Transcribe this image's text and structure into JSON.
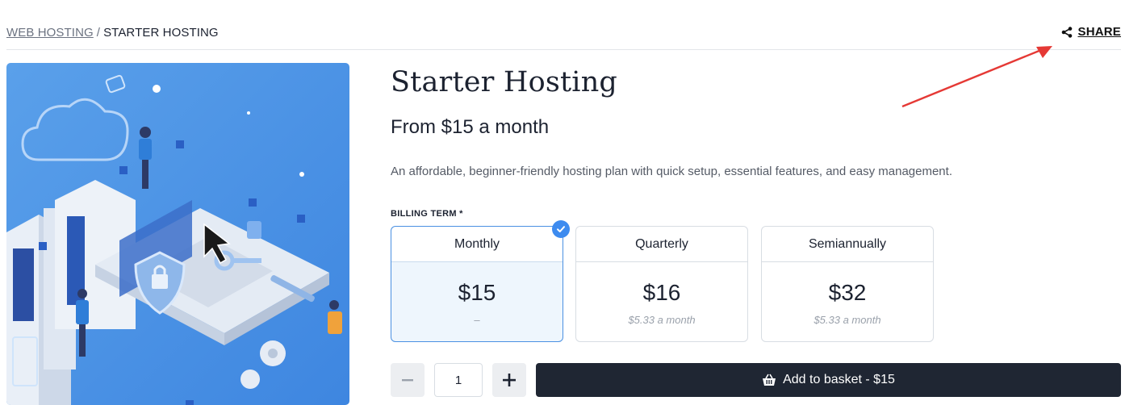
{
  "breadcrumb": {
    "parent": "WEB HOSTING",
    "separator": "/",
    "current": "STARTER HOSTING"
  },
  "share": {
    "label": "SHARE",
    "icon": "share-icon"
  },
  "product": {
    "title": "Starter Hosting",
    "price_from": "From $15 a month",
    "description": "An affordable, beginner-friendly hosting plan with quick setup, essential features, and easy management."
  },
  "billing": {
    "label": "BILLING TERM *",
    "terms": [
      {
        "name": "Monthly",
        "price": "$15",
        "note": "–",
        "selected": true
      },
      {
        "name": "Quarterly",
        "price": "$16",
        "note": "$5.33 a month",
        "selected": false
      },
      {
        "name": "Semiannually",
        "price": "$32",
        "note": "$5.33 a month",
        "selected": false
      }
    ]
  },
  "quantity": {
    "value": "1",
    "decrement_icon": "minus-icon",
    "increment_icon": "plus-icon"
  },
  "add_to_basket": {
    "label": "Add to basket - $15",
    "icon": "basket-icon"
  },
  "colors": {
    "accent": "#3d8bef",
    "button_dark": "#1f2633",
    "annotation_arrow": "#e53935",
    "hero_bg": "#4a90e2"
  }
}
